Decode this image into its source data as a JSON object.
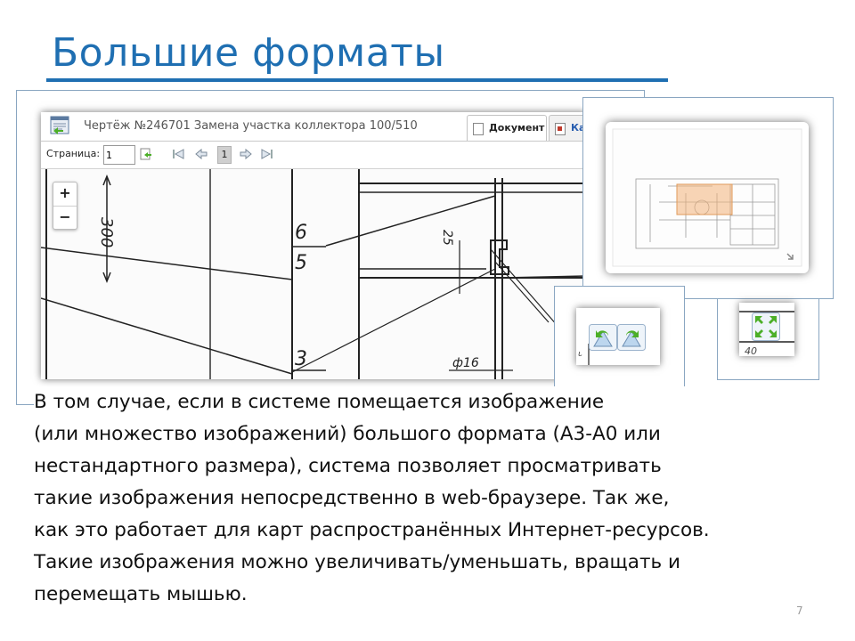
{
  "slide": {
    "title": "Большие форматы",
    "page_number": "7",
    "paragraph_lines": [
      "В том случае, если в системе помещается изображение",
      "(или множество изображений) большого формата (А3-А0 или",
      "нестандартного размера), система позволяет просматривать",
      "такие изображения непосредственно в web-браузере. Так же,",
      "как это работает для карт распространённых Интернет-ресурсов.",
      "Такие изображения можно увеличивать/уменьшать, вращать и",
      "перемещать мышью."
    ]
  },
  "viewer": {
    "document_title": "Чертёж №246701 Замена участка коллектора 100/510",
    "tabs": [
      {
        "label": "Документ",
        "active": true
      },
      {
        "label": "Ка",
        "active": false
      }
    ],
    "toolbar": {
      "page_label": "Страница:",
      "page_value": "1",
      "current_page": "1"
    },
    "zoom": {
      "plus": "+",
      "minus": "−"
    },
    "drawing_labels": {
      "dim_300": "300",
      "callout_6": "6",
      "callout_5": "5",
      "callout_3": "3",
      "dim_25": "25",
      "dim_phi16": "ф16"
    }
  },
  "colors": {
    "title_blue": "#1f6fb2",
    "frame_border": "#8aa6c1",
    "overview_highlight": "#f3b27a"
  }
}
